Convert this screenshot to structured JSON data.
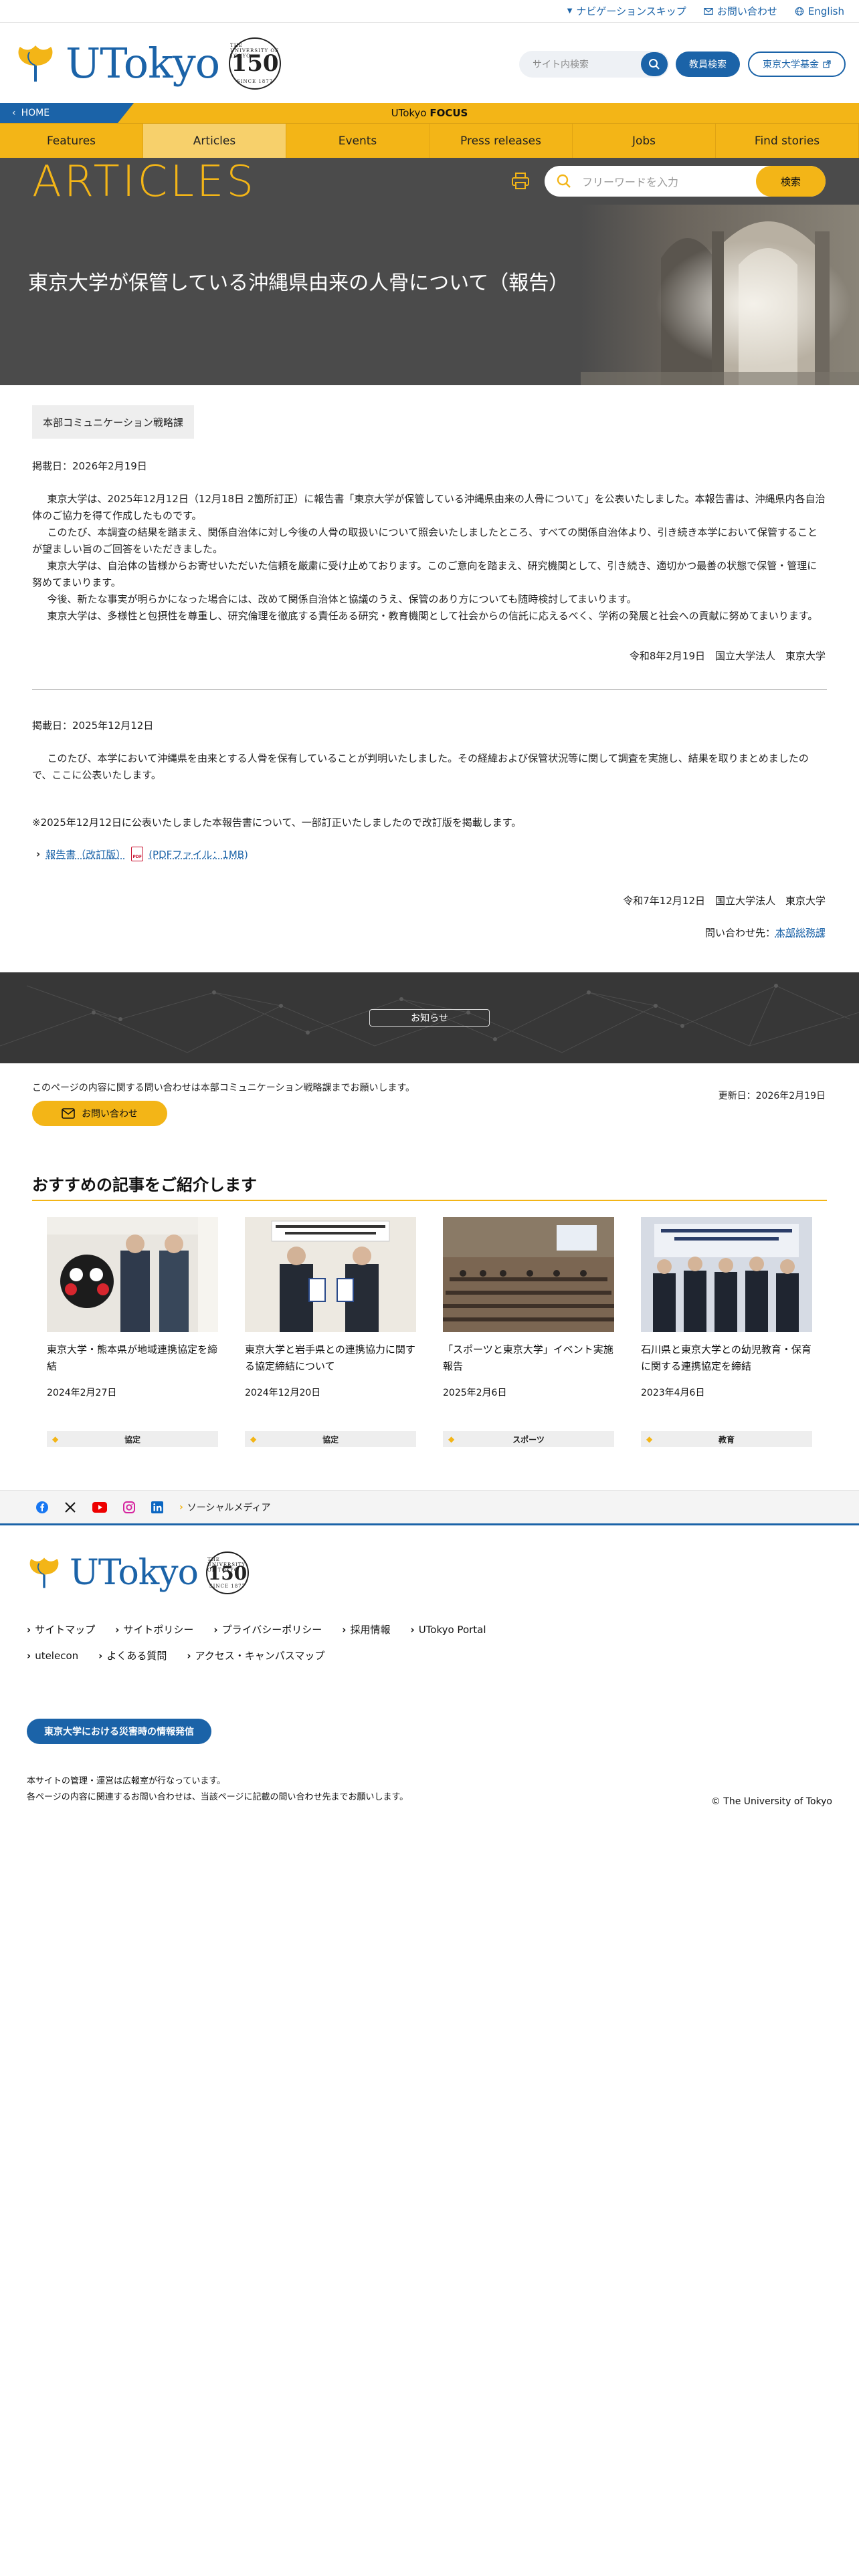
{
  "utility": {
    "skip_nav": "ナビゲーションスキップ",
    "contact": "お問い合わせ",
    "english": "English"
  },
  "header": {
    "logo_text": "UTokyo",
    "seal_top": "THE UNIVERSITY OF TOKYO",
    "seal_number": "150",
    "seal_bottom": "SINCE 1877",
    "search_placeholder": "サイト内検索",
    "staff_search": "教員検索",
    "fund": "東京大学基金"
  },
  "focusbar": {
    "home": "HOME",
    "label_prefix": "UTokyo",
    "label_bold": "FOCUS"
  },
  "nav": {
    "items": [
      "Features",
      "Articles",
      "Events",
      "Press releases",
      "Jobs",
      "Find stories"
    ]
  },
  "band": {
    "title": "ARTICLES",
    "search_placeholder": "フリーワードを入力",
    "search_button": "検索"
  },
  "hero": {
    "title": "東京大学が保管している沖縄県由来の人骨について（報告）"
  },
  "article": {
    "department": "本部コミュニケーション戦略課",
    "date1": "掲載日：2026年2月19日",
    "paragraphs1": [
      "東京大学は、2025年12月12日（12月18日 2箇所訂正）に報告書「東京大学が保管している沖縄県由来の人骨について」を公表いたしました。本報告書は、沖縄県内各自治体のご協力を得て作成したものです。",
      "このたび、本調査の結果を踏まえ、関係自治体に対し今後の人骨の取扱いについて照会いたしましたところ、すべての関係自治体より、引き続き本学において保管することが望ましい旨のご回答をいただきました。",
      "東京大学は、自治体の皆様からお寄せいただいた信頼を厳粛に受け止めております。このご意向を踏まえ、研究機関として、引き続き、適切かつ最善の状態で保管・管理に努めてまいります。",
      "今後、新たな事実が明らかになった場合には、改めて関係自治体と協議のうえ、保管のあり方についても随時検討してまいります。",
      "東京大学は、多様性と包摂性を尊重し、研究倫理を徹底する責任ある研究・教育機関として社会からの信託に応えるべく、学術の発展と社会への貢献に努めてまいります。"
    ],
    "signature1": "令和8年2月19日　国立大学法人　東京大学",
    "date2": "掲載日：2025年12月12日",
    "paragraph2": "このたび、本学において沖縄県を由来とする人骨を保有していることが判明いたしました。その経緯および保管状況等に関して調査を実施し、結果を取りまとめましたので、ここに公表いたします。",
    "note": "※2025年12月12日に公表いたしました本報告書について、一部訂正いたしましたので改訂版を掲載します。",
    "report_link": "報告書（改訂版）",
    "pdf_label": "PDF",
    "pdf_info": "(PDFファイル：1MB)",
    "signature2": "令和7年12月12日　国立大学法人　東京大学",
    "inquiry_label": "問い合わせ先：",
    "inquiry_link": "本部総務課"
  },
  "news": {
    "button": "お知らせ"
  },
  "page_footer": {
    "inquiry_text": "このページの内容に関する問い合わせは本部コミュニケーション戦略課までお願いします。",
    "updated": "更新日：2026年2月19日",
    "inquiry_button": "お問い合わせ"
  },
  "recommended": {
    "title": "おすすめの記事をご紹介します",
    "cards": [
      {
        "title": "東京大学・熊本県が地域連携協定を締結",
        "date": "2024年2月27日",
        "tag": "協定"
      },
      {
        "title": "東京大学と岩手県との連携協力に関する協定締結について",
        "date": "2024年12月20日",
        "tag": "協定"
      },
      {
        "title": "「スポーツと東京大学」イベント実施報告",
        "date": "2025年2月6日",
        "tag": "スポーツ"
      },
      {
        "title": "石川県と東京大学との幼児教育・保育に関する連携協定を締結",
        "date": "2023年4月6日",
        "tag": "教育"
      }
    ]
  },
  "social": {
    "label": "ソーシャルメディア"
  },
  "footer": {
    "links": [
      "サイトマップ",
      "サイトポリシー",
      "プライバシーポリシー",
      "採用情報",
      "UTokyo Portal",
      "utelecon",
      "よくある質問",
      "アクセス・キャンパスマップ"
    ],
    "disaster": "東京大学における災害時の情報発信",
    "note1": "本サイトの管理・運営は広報室が行なっています。",
    "note2": "各ページの内容に関連するお問い合わせは、当該ページに記載の問い合わせ先までお願いします。",
    "copyright": "© The University of Tokyo"
  },
  "colors": {
    "brand_blue": "#1b63a8",
    "brand_yellow": "#f3b517",
    "dark_band": "#4b4b4b"
  }
}
